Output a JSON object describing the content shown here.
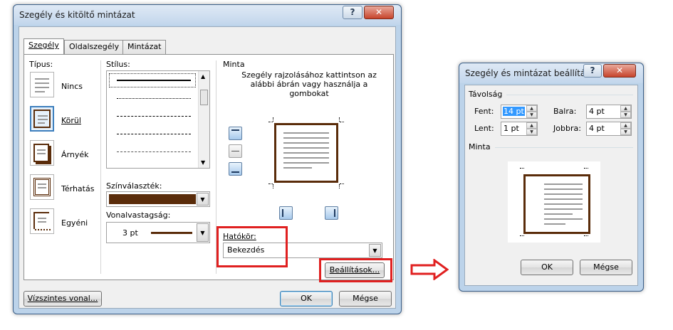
{
  "main_dialog": {
    "title": "Szegély és kitöltő mintázat",
    "help_glyph": "?",
    "close_glyph": "✕",
    "tabs": [
      "Szegély",
      "Oldalszegély",
      "Mintázat"
    ],
    "type_label": "Típus:",
    "types": [
      "Nincs",
      "Körül",
      "Árnyék",
      "Térhatás",
      "Egyéni"
    ],
    "style_label": "Stílus:",
    "color_label": "Színválaszték:",
    "color_value": "#5a2c0a",
    "width_label": "Vonalvastagság:",
    "width_value": "3 pt",
    "preview_label": "Minta",
    "preview_hint": "Szegély rajzolásához kattintson az alábbi ábrán vagy használja a gombokat",
    "scope_label": "Hatókör:",
    "scope_value": "Bekezdés",
    "settings_button": "Beállítások...",
    "horizontal_line_button": "Vízszintes vonal...",
    "ok_button": "OK",
    "cancel_button": "Mégse"
  },
  "options_dialog": {
    "title": "Szegély és mintázat beállításai",
    "help_glyph": "?",
    "close_glyph": "✕",
    "distance_label": "Távolság",
    "top_label": "Fent:",
    "top_value": "14 pt",
    "left_label": "Balra:",
    "left_value": "4 pt",
    "bottom_label": "Lent:",
    "bottom_value": "1 pt",
    "right_label": "Jobbra:",
    "right_value": "4 pt",
    "preview_label": "Minta",
    "ok_button": "OK",
    "cancel_button": "Mégse"
  },
  "colors": {
    "border_brown": "#5a2c0a",
    "highlight_red": "#e02020",
    "selection_blue": "#3399ff"
  }
}
